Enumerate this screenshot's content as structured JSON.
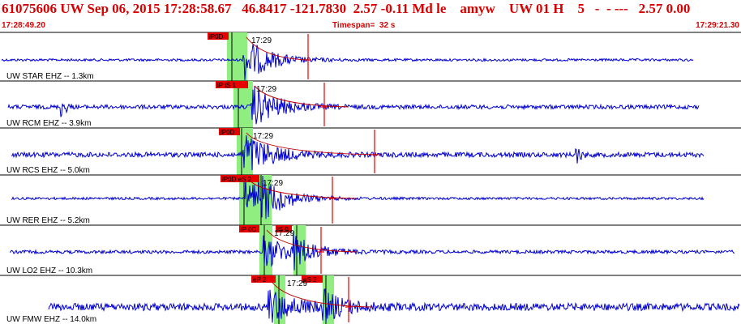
{
  "header": {
    "title": "61075606 UW Sep 06, 2015 17:28:58.67   46.8417 -121.7830  2.57 -0.11 Md le    amyw    UW 01 H    5   -  - ---   2.57 0.00",
    "start_time": "17:28:49.20",
    "timespan": "Timespan=  32 s",
    "end_time": "17:29:21.30"
  },
  "colors": {
    "header_text": "#d80000",
    "trace": "#0000d0",
    "pick_box": "#e80000",
    "pick_band": "#90ee80",
    "decay_curve": "#c00000",
    "separator": "#000000"
  },
  "traces": [
    {
      "label": "UW STAR EHZ -- 1.3km",
      "time_label": "17:29",
      "picks": [
        {
          "text": "iP0D",
          "kind": "P"
        }
      ]
    },
    {
      "label": "UW RCM EHZ -- 3.9km",
      "time_label": "17:29",
      "picks": [
        {
          "text": "iP iS 1",
          "kind": "P"
        }
      ]
    },
    {
      "label": "UW RCS EHZ -- 5.0km",
      "time_label": "17:29",
      "picks": [
        {
          "text": "iP0D",
          "kind": "P"
        }
      ]
    },
    {
      "label": "UW RER EHZ -- 5.2km",
      "time_label": "17:29",
      "picks": [
        {
          "text": "iP0D eS 2",
          "kind": "P"
        }
      ]
    },
    {
      "label": "UW LO2 EHZ -- 10.3km",
      "time_label": "17:29",
      "picks": [
        {
          "text": "iP 0D",
          "kind": "P"
        },
        {
          "text": "iS 0",
          "kind": "S"
        }
      ]
    },
    {
      "label": "UW FMW EHZ -- 14.0km",
      "time_label": "17:29",
      "picks": [
        {
          "text": "eP 2",
          "kind": "P"
        },
        {
          "text": "eS 2",
          "kind": "S"
        }
      ]
    }
  ]
}
